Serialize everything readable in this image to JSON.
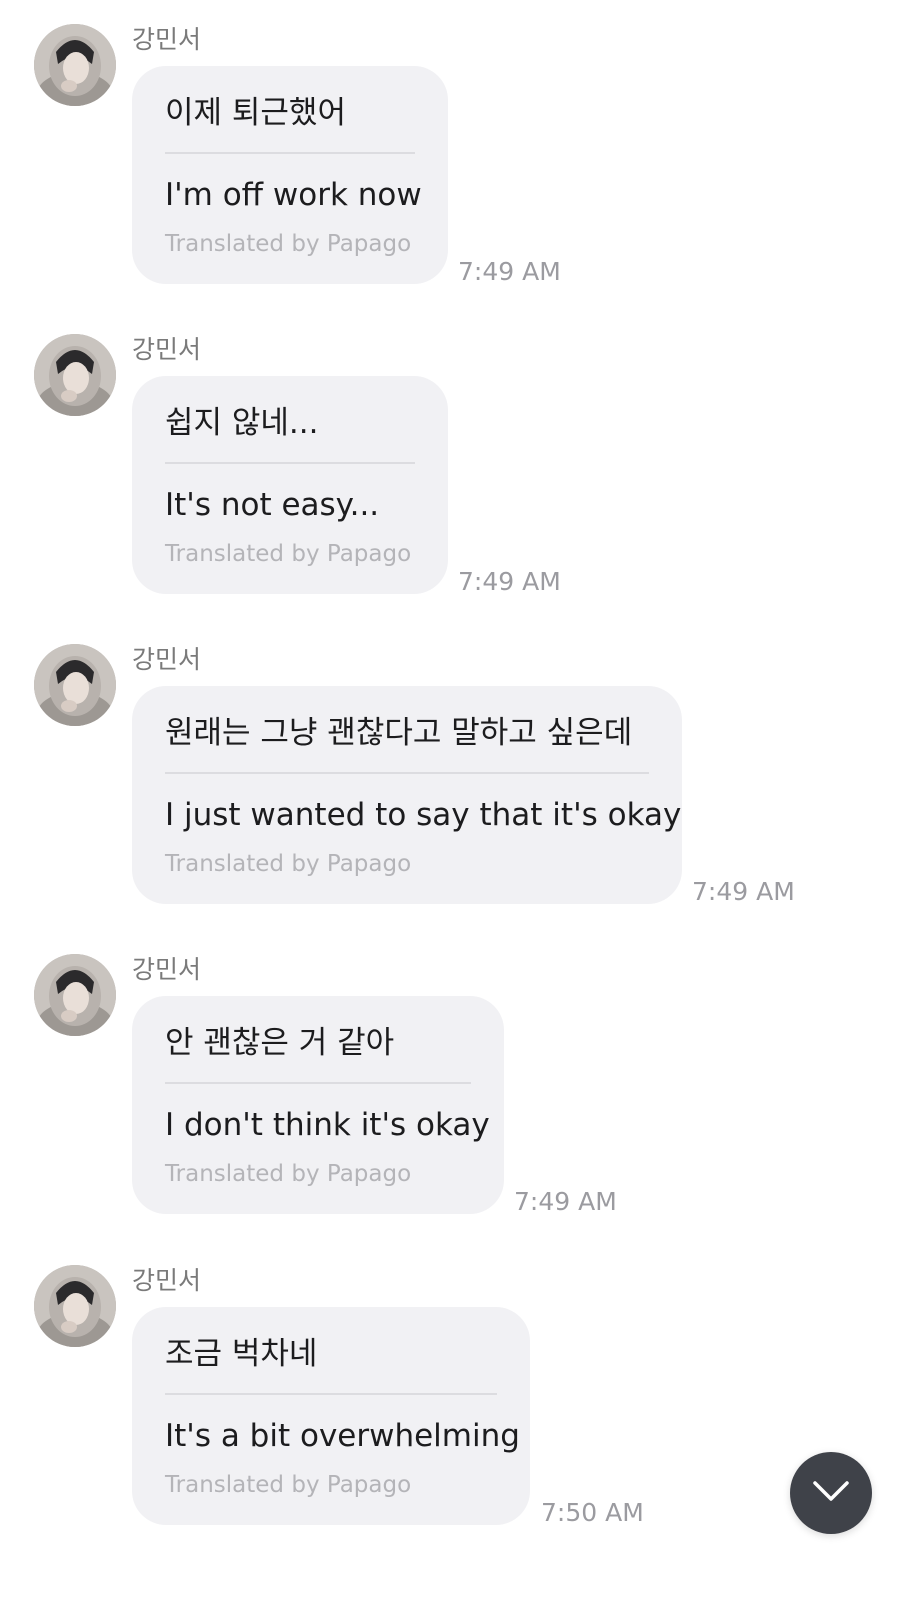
{
  "messages": [
    {
      "sender": "강민서",
      "original": "이제 퇴근했어",
      "translation": "I'm off work now",
      "credit": "Translated by Papago",
      "time": "7:49 AM"
    },
    {
      "sender": "강민서",
      "original": "쉽지 않네...",
      "translation": "It's not easy...",
      "credit": "Translated by Papago",
      "time": "7:49 AM"
    },
    {
      "sender": "강민서",
      "original": "원래는 그냥 괜찮다고 말하고 싶은데",
      "translation": "I just wanted to say that it's okay",
      "credit": "Translated by Papago",
      "time": "7:49 AM"
    },
    {
      "sender": "강민서",
      "original": "안 괜찮은 거 같아",
      "translation": "I don't think it's okay",
      "credit": "Translated by Papago",
      "time": "7:49 AM"
    },
    {
      "sender": "강민서",
      "original": "조금 벅차네",
      "translation": "It's a bit overwhelming",
      "credit": "Translated by Papago",
      "time": "7:50 AM"
    }
  ],
  "scroll_button": {
    "icon": "chevron-down-icon"
  }
}
